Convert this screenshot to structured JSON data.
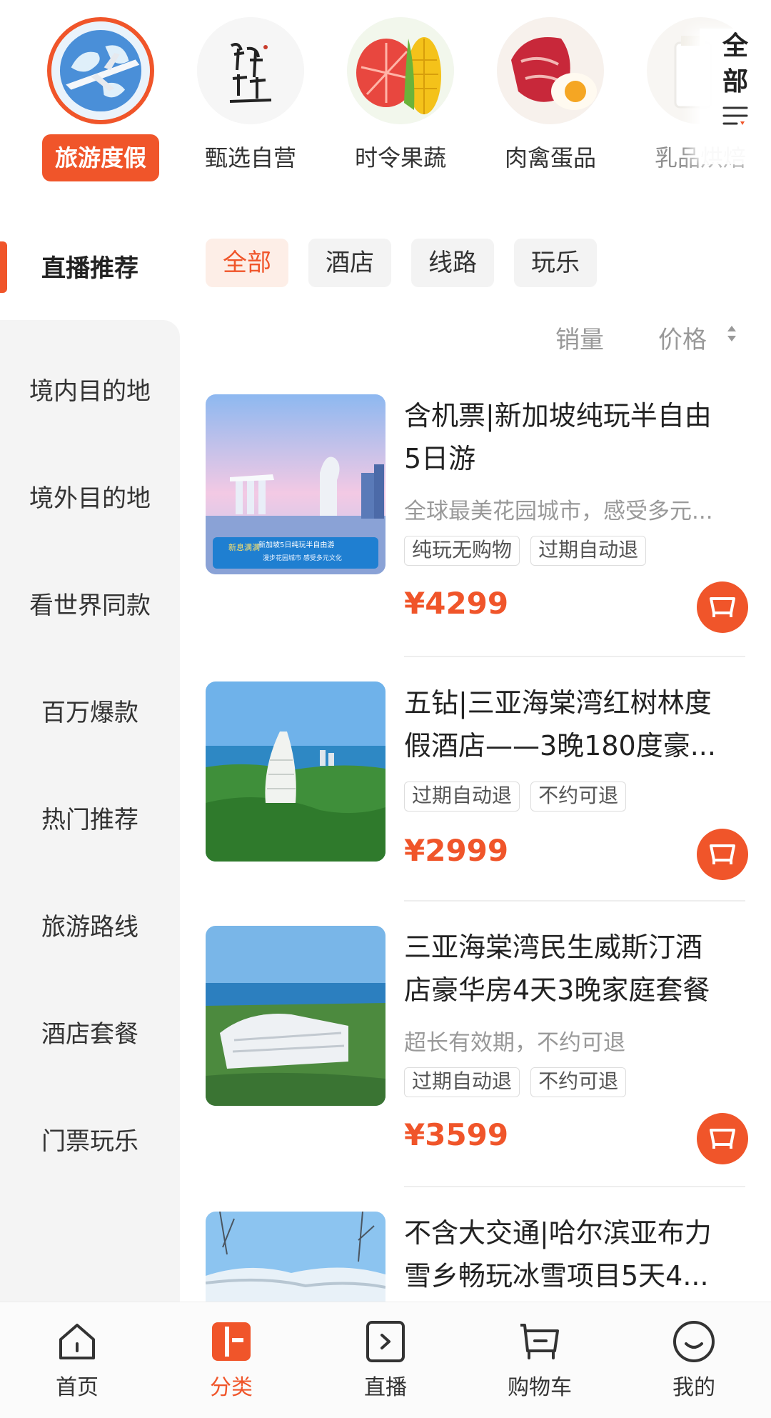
{
  "categories": [
    {
      "label": "旅游度假",
      "icon": "airplane-globe-icon",
      "active": true
    },
    {
      "label": "甄选自营",
      "icon": "brand-logo-icon",
      "active": false
    },
    {
      "label": "时令果蔬",
      "icon": "fruit-vegetable-icon",
      "active": false
    },
    {
      "label": "肉禽蛋品",
      "icon": "meat-egg-icon",
      "active": false
    },
    {
      "label": "乳品烘焙",
      "icon": "dairy-icon",
      "active": false
    }
  ],
  "all_button": {
    "line1": "全",
    "line2": "部"
  },
  "sidebar": {
    "active": "直播推荐",
    "items": [
      "境内目的地",
      "境外目的地",
      "看世界同款",
      "百万爆款",
      "热门推荐",
      "旅游路线",
      "酒店套餐",
      "门票玩乐"
    ]
  },
  "filters": [
    "全部",
    "酒店",
    "线路",
    "玩乐"
  ],
  "sort": {
    "sales": "销量",
    "price": "价格"
  },
  "products": [
    {
      "title_lines": [
        "含机票|新加坡纯玩半自由",
        "5日游"
      ],
      "subtitle": "全球最美花园城市，感受多元...",
      "tags": [
        "纯玩无购物",
        "过期自动退"
      ],
      "price": "¥4299",
      "badge_left": "新息满满",
      "badge_title": "新加坡5日纯玩半自由游",
      "badge_sub": "漫步花园城市 感受多元文化"
    },
    {
      "title_lines": [
        "五钻|三亚海棠湾红树林度",
        "假酒店——3晚180度豪..."
      ],
      "subtitle": "",
      "tags": [
        "过期自动退",
        "不约可退"
      ],
      "price": "¥2999"
    },
    {
      "title_lines": [
        "三亚海棠湾民生威斯汀酒",
        "店豪华房4天3晚家庭套餐"
      ],
      "subtitle": "超长有效期，不约可退",
      "tags": [
        "过期自动退",
        "不约可退"
      ],
      "price": "¥3599"
    },
    {
      "title_lines": [
        "不含大交通|哈尔滨亚布力",
        "雪乡畅玩冰雪项目5天4..."
      ],
      "subtitle": "",
      "tags": [],
      "price": ""
    }
  ],
  "bottom_nav": [
    {
      "label": "首页",
      "icon": "home-icon",
      "active": false
    },
    {
      "label": "分类",
      "icon": "category-icon",
      "active": true
    },
    {
      "label": "直播",
      "icon": "live-icon",
      "active": false
    },
    {
      "label": "购物车",
      "icon": "cart-icon",
      "active": false
    },
    {
      "label": "我的",
      "icon": "profile-icon",
      "active": false
    }
  ],
  "colors": {
    "accent": "#f0552a",
    "sidebar_bg": "#f4f4f4",
    "tag_border": "#dddddd"
  }
}
